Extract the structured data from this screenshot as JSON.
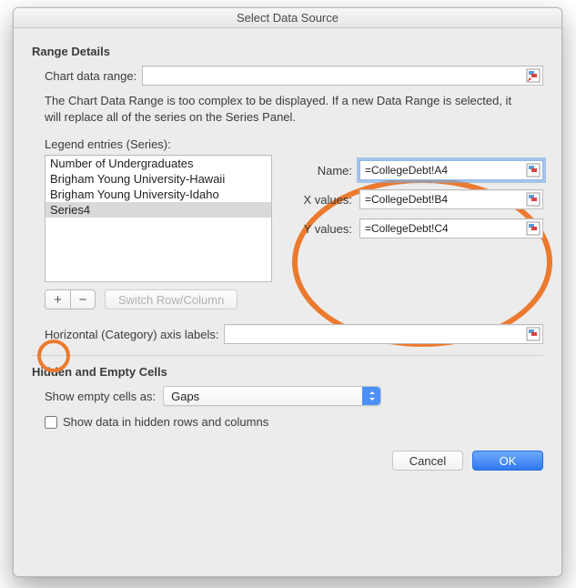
{
  "titlebar": "Select Data Source",
  "section_range": "Range Details",
  "chart_range_label": "Chart data range:",
  "chart_range_value": "",
  "chart_range_note": "The Chart Data Range is too complex to be displayed. If a new Data Range is selected, it will replace all of the series on the Series Panel.",
  "legend_label": "Legend entries (Series):",
  "series": [
    "Number of Undergraduates",
    "Brigham Young University-Hawaii",
    "Brigham Young University-Idaho",
    "Series4"
  ],
  "selected_series_index": 3,
  "add_label": "+",
  "remove_label": "−",
  "switch_label": "Switch Row/Column",
  "fields": {
    "name_label": "Name:",
    "name_value": "=CollegeDebt!A4",
    "x_label": "X values:",
    "x_value": "=CollegeDebt!B4",
    "y_label": "Y values:",
    "y_value": "=CollegeDebt!C4"
  },
  "axis_label": "Horizontal (Category) axis labels:",
  "axis_value": "",
  "section_hidden": "Hidden and Empty Cells",
  "empty_cells_label": "Show empty cells as:",
  "empty_cells_value": "Gaps",
  "checkbox_label": "Show data in hidden rows and columns",
  "checkbox_checked": false,
  "cancel_label": "Cancel",
  "ok_label": "OK"
}
